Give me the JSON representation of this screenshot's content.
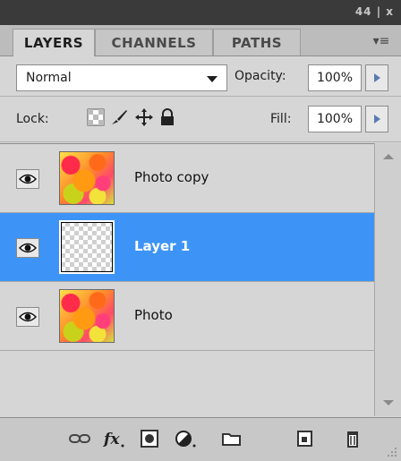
{
  "tabs": [
    {
      "label": "LAYERS",
      "active": true
    },
    {
      "label": "CHANNELS",
      "active": false
    },
    {
      "label": "PATHS",
      "active": false
    }
  ],
  "titlebar": {
    "controls": "44 | x"
  },
  "blend_mode": {
    "value": "Normal"
  },
  "opacity": {
    "label": "Opacity:",
    "value": "100%"
  },
  "lock": {
    "label": "Lock:",
    "icons": [
      "lock-transparent-pixels-icon",
      "lock-image-pixels-icon",
      "lock-position-icon",
      "lock-all-icon"
    ]
  },
  "fill": {
    "label": "Fill:",
    "value": "100%"
  },
  "layers": [
    {
      "name": "Photo copy",
      "visible": true,
      "selected": false,
      "thumbnail": "photo"
    },
    {
      "name": "Layer 1",
      "visible": true,
      "selected": true,
      "thumbnail": "transparent"
    },
    {
      "name": "Photo",
      "visible": true,
      "selected": false,
      "thumbnail": "photo"
    }
  ],
  "bottom_icons": [
    "link-layers-icon",
    "fx-icon",
    "add-mask-icon",
    "adjustment-layer-icon",
    "new-group-icon",
    "new-layer-icon",
    "delete-layer-icon"
  ],
  "colors": {
    "selection": "#3d94f6",
    "panel": "#d6d6d6",
    "titlebar": "#3a3a3a"
  }
}
